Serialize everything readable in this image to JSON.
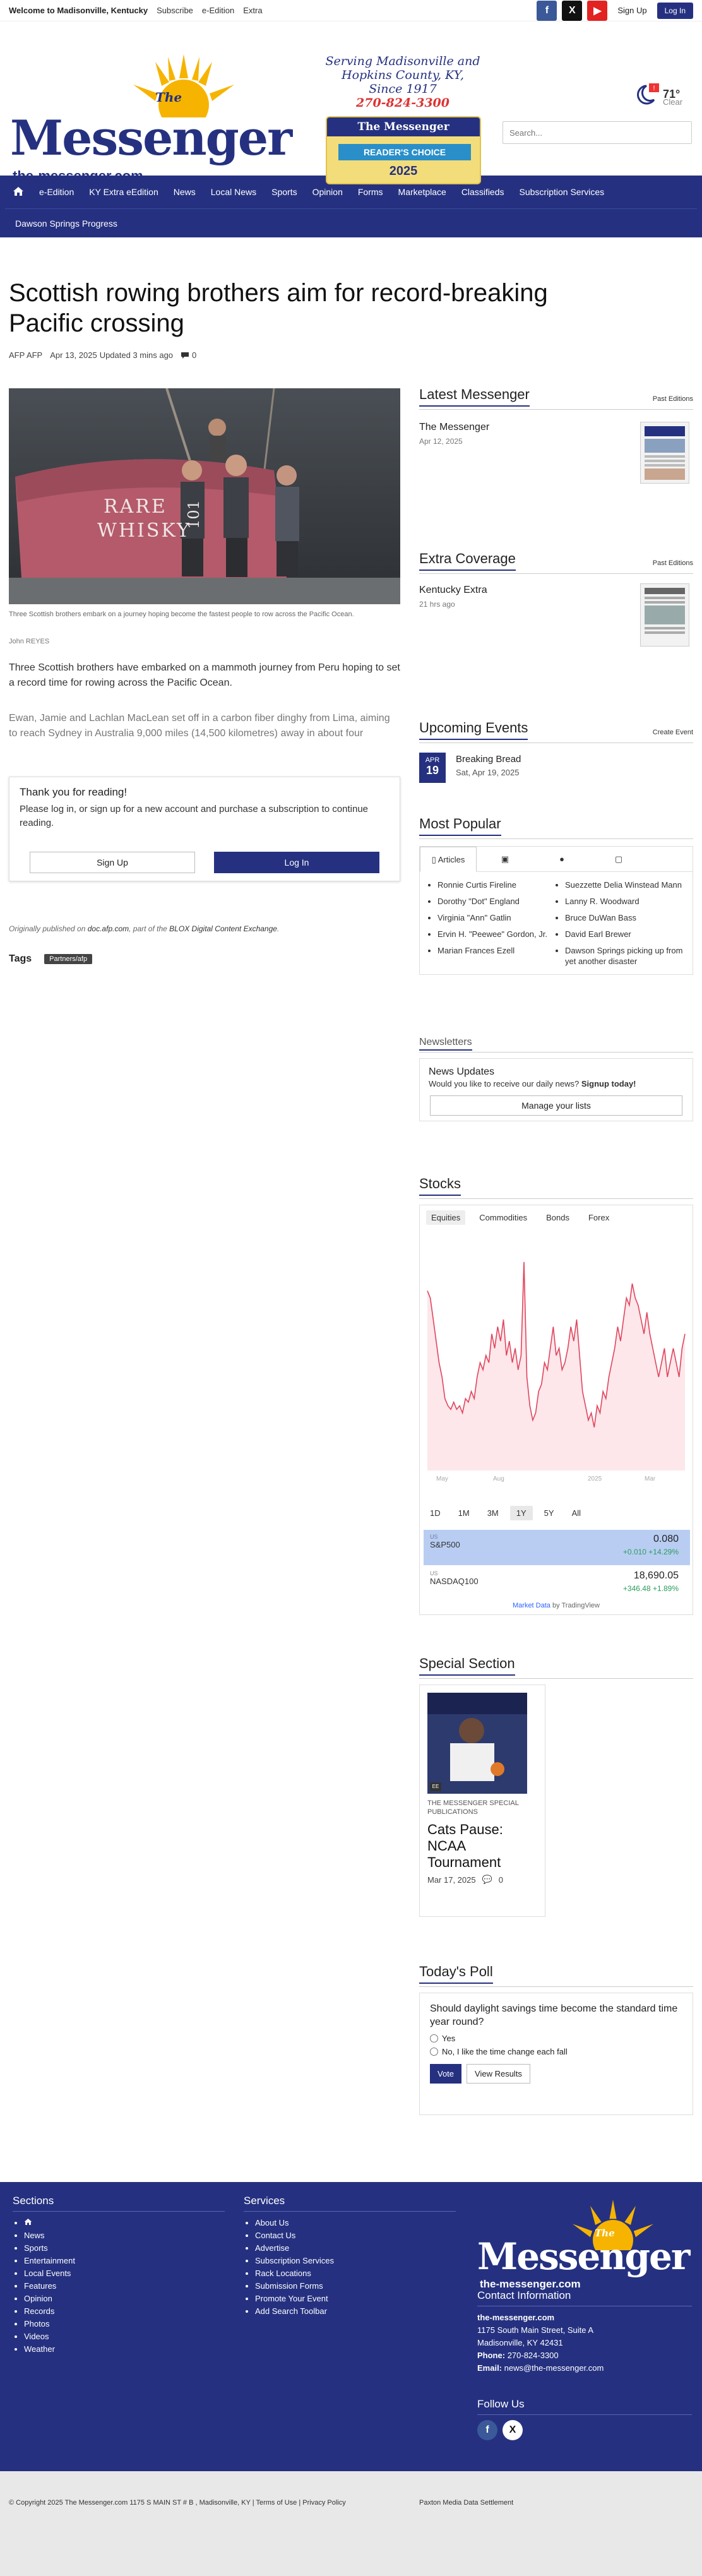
{
  "topbar": {
    "welcome": "Welcome to Madisonville, Kentucky",
    "links": [
      "Subscribe",
      "e-Edition",
      "Extra"
    ],
    "signup": "Sign Up",
    "login": "Log In"
  },
  "masthead": {
    "logo_the": "The",
    "logo_name": "Messenger",
    "logo_url": "the-messenger.com",
    "promo_line1": "Serving Madisonville and",
    "promo_line2": "Hopkins County, KY,",
    "promo_line3": "Since 1917",
    "promo_phone": "270-824-3300",
    "badge_title": "The Messenger",
    "badge_ribbon": "READER'S CHOICE",
    "badge_year": "2025",
    "weather_temp": "71°",
    "weather_cond": "Clear",
    "search_placeholder": "Search..."
  },
  "nav": {
    "items": [
      "e-Edition",
      "KY Extra eEdition",
      "News",
      "Local News",
      "Sports",
      "Opinion",
      "Forms",
      "Marketplace",
      "Classifieds",
      "Subscription Services"
    ],
    "row2": "Dawson Springs Progress"
  },
  "article": {
    "headline": "Scottish rowing brothers aim for record-breaking Pacific crossing",
    "author": "AFP AFP",
    "date": "Apr 13, 2025",
    "updated": "Updated 3 mins ago",
    "comments": "0",
    "photo_text1": "RARE",
    "photo_text2": "WHISKY",
    "photo_text3": "101",
    "caption": "Three Scottish brothers embark on a journey hoping become the fastest people to row across the Pacific Ocean.",
    "credit": "John REYES",
    "p1": "Three Scottish brothers have embarked on a mammoth journey from Peru hoping to set a record time for rowing across the Pacific Ocean.",
    "p2": "Ewan, Jamie and Lachlan MacLean set off in a carbon fiber dinghy from Lima, aiming to reach Sydney in Australia 9,000 miles (14,500 kilometres) away in about four",
    "paywall_title": "Thank you for reading!",
    "paywall_text": "Please log in, or sign up for a new account and purchase a subscription to continue reading.",
    "paywall_signup": "Sign Up",
    "paywall_login": "Log In",
    "orig_prefix": "Originally published on",
    "orig_site": "doc.afp.com",
    "orig_mid": ", part of the",
    "orig_exchange": "BLOX Digital Content Exchange",
    "orig_end": ".",
    "tags_label": "Tags",
    "tag1": "Partners/afp"
  },
  "sidebar": {
    "latest_title": "Latest Messenger",
    "latest_more": "Past Editions",
    "latest_item": "The Messenger",
    "latest_date": "Apr 12, 2025",
    "extra_title": "Extra Coverage",
    "extra_more": "Past Editions",
    "extra_item": "Kentucky Extra",
    "extra_date": "21 hrs ago",
    "events_title": "Upcoming Events",
    "events_more": "Create Event",
    "event_month": "APR",
    "event_day": "19",
    "event_name": "Breaking Bread",
    "event_date": "Sat, Apr 19, 2025",
    "popular_title": "Most Popular",
    "popular_tab": "Articles",
    "popular_left": [
      "Ronnie Curtis Fireline",
      "Dorothy \"Dot\" England",
      "Virginia \"Ann\" Gatlin",
      "Ervin H. \"Peewee\" Gordon, Jr.",
      "Marian Frances Ezell"
    ],
    "popular_right": [
      "Suezzette Delia Winstead Mann",
      "Lanny R. Woodward",
      "Bruce DuWan Bass",
      "David Earl Brewer",
      "Dawson Springs picking up from yet another disaster"
    ],
    "newsletters_title": "Newsletters",
    "nl_head": "News Updates",
    "nl_text": "Would you like to receive our daily news?",
    "nl_signup": "Signup today!",
    "nl_btn": "Manage your lists",
    "stocks_title": "Stocks",
    "stock_tabs": [
      "Equities",
      "Commodities",
      "Bonds",
      "Forex"
    ],
    "stock_ranges": [
      "1D",
      "1M",
      "3M",
      "1Y",
      "5Y",
      "All"
    ],
    "ticker1_sym": "S&P500",
    "ticker1_val": "0.080",
    "ticker1_chg": "+0.010 +14.29%",
    "ticker2_sym": "NASDAQ100",
    "ticker2_val": "18,690.05",
    "ticker2_chg": "+346.48 +1.89%",
    "stock_footer_a": "Market Data",
    "stock_footer_b": " by TradingView",
    "x_labels": [
      "May",
      "Aug",
      "2025",
      "Mar"
    ],
    "special_title": "Special Section",
    "special_kicker": "THE MESSENGER SPECIAL PUBLICATIONS",
    "special_head": "Cats Pause: NCAA Tournament",
    "special_date": "Mar 17, 2025",
    "special_comments": "0",
    "poll_title": "Today's Poll",
    "poll_q": "Should daylight savings time become the standard time year round?",
    "poll_opt1": "Yes",
    "poll_opt2": "No, I like the time change each fall",
    "poll_vote": "Vote",
    "poll_results": "View Results"
  },
  "chart_data": {
    "type": "line",
    "title": "",
    "xlabel": "",
    "ylabel": "",
    "x_ticks": [
      "May",
      "Aug",
      "2025",
      "Mar"
    ],
    "series": [
      {
        "values": [
          0.08,
          0.078,
          0.072,
          0.066,
          0.06,
          0.056,
          0.05,
          0.048,
          0.047,
          0.049,
          0.047,
          0.048,
          0.046,
          0.05,
          0.049,
          0.052,
          0.05,
          0.056,
          0.06,
          0.058,
          0.062,
          0.06,
          0.068,
          0.064,
          0.07,
          0.066,
          0.072,
          0.062,
          0.066,
          0.06,
          0.064,
          0.058,
          0.062,
          0.088,
          0.056,
          0.048,
          0.044,
          0.046,
          0.052,
          0.054,
          0.06,
          0.058,
          0.064,
          0.07,
          0.062,
          0.064,
          0.058,
          0.06,
          0.064,
          0.07,
          0.066,
          0.072,
          0.062,
          0.052,
          0.048,
          0.044,
          0.046,
          0.042,
          0.048,
          0.046,
          0.052,
          0.05,
          0.056,
          0.06,
          0.064,
          0.07,
          0.066,
          0.072,
          0.078,
          0.076,
          0.082,
          0.078,
          0.076,
          0.072,
          0.068,
          0.074,
          0.068,
          0.064,
          0.06,
          0.056,
          0.06,
          0.064,
          0.056,
          0.06,
          0.064,
          0.06,
          0.056,
          0.064,
          0.068
        ]
      }
    ]
  },
  "footer": {
    "sections_title": "Sections",
    "sections": [
      "News",
      "Sports",
      "Entertainment",
      "Local Events",
      "Features",
      "Opinion",
      "Records",
      "Photos",
      "Videos",
      "Weather"
    ],
    "services_title": "Services",
    "services": [
      "About Us",
      "Contact Us",
      "Advertise",
      "Subscription Services",
      "Rack Locations",
      "Submission Forms",
      "Promote Your Event",
      "Add Search Toolbar"
    ],
    "logo_the": "The",
    "logo_name": "Messenger",
    "logo_url": "the-messenger.com",
    "contact_title": "Contact Information",
    "contact_site": "the-messenger.com",
    "contact_addr1": "1175 South Main Street, Suite A",
    "contact_addr2": "Madisonville, KY 42431",
    "phone_label": "Phone:",
    "phone": "270-824-3300",
    "email_label": "Email:",
    "email": "news@the-messenger.com",
    "follow_title": "Follow Us",
    "copyright": "© Copyright 2025 The Messenger.com 1175 S MAIN ST # B , Madisonville, KY",
    "terms": "Terms of Use",
    "privacy": "Privacy Policy",
    "settlement": "Paxton Media Data Settlement"
  },
  "colors": {
    "brand": "#253180",
    "chart_line": "#e0455e",
    "gain": "#2a9d5b"
  }
}
